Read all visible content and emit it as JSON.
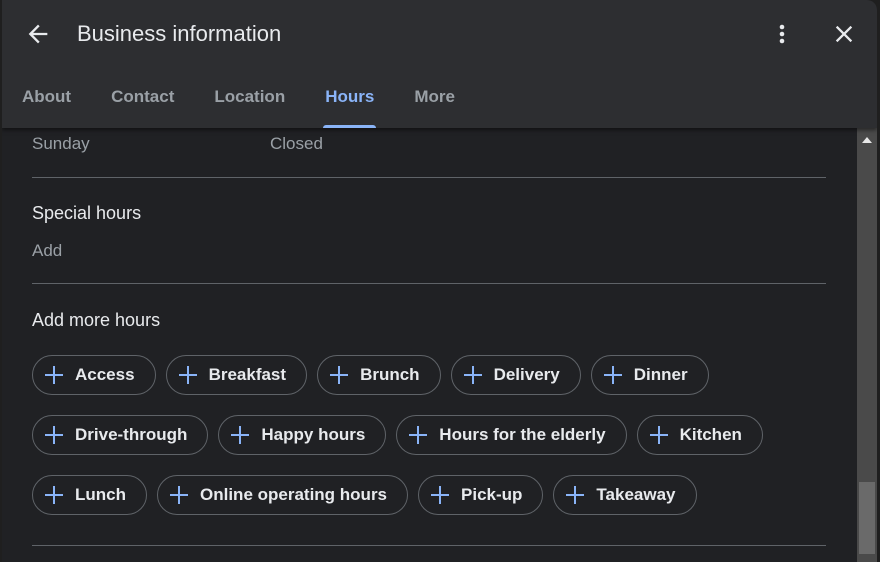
{
  "header": {
    "title": "Business information"
  },
  "tabs": [
    {
      "label": "About"
    },
    {
      "label": "Contact"
    },
    {
      "label": "Location"
    },
    {
      "label": "Hours",
      "active": true
    },
    {
      "label": "More"
    }
  ],
  "hours": {
    "day": "Sunday",
    "value": "Closed"
  },
  "special_hours": {
    "title": "Special hours",
    "action": "Add"
  },
  "more_hours": {
    "title": "Add more hours",
    "rows": [
      [
        "Access",
        "Breakfast",
        "Brunch",
        "Delivery",
        "Dinner"
      ],
      [
        "Drive-through",
        "Happy hours",
        "Hours for the elderly",
        "Kitchen"
      ],
      [
        "Lunch",
        "Online operating hours",
        "Pick-up",
        "Takeaway"
      ]
    ]
  },
  "colors": {
    "accent": "#8ab4f8",
    "background": "#202124",
    "header": "#2d2e31"
  }
}
